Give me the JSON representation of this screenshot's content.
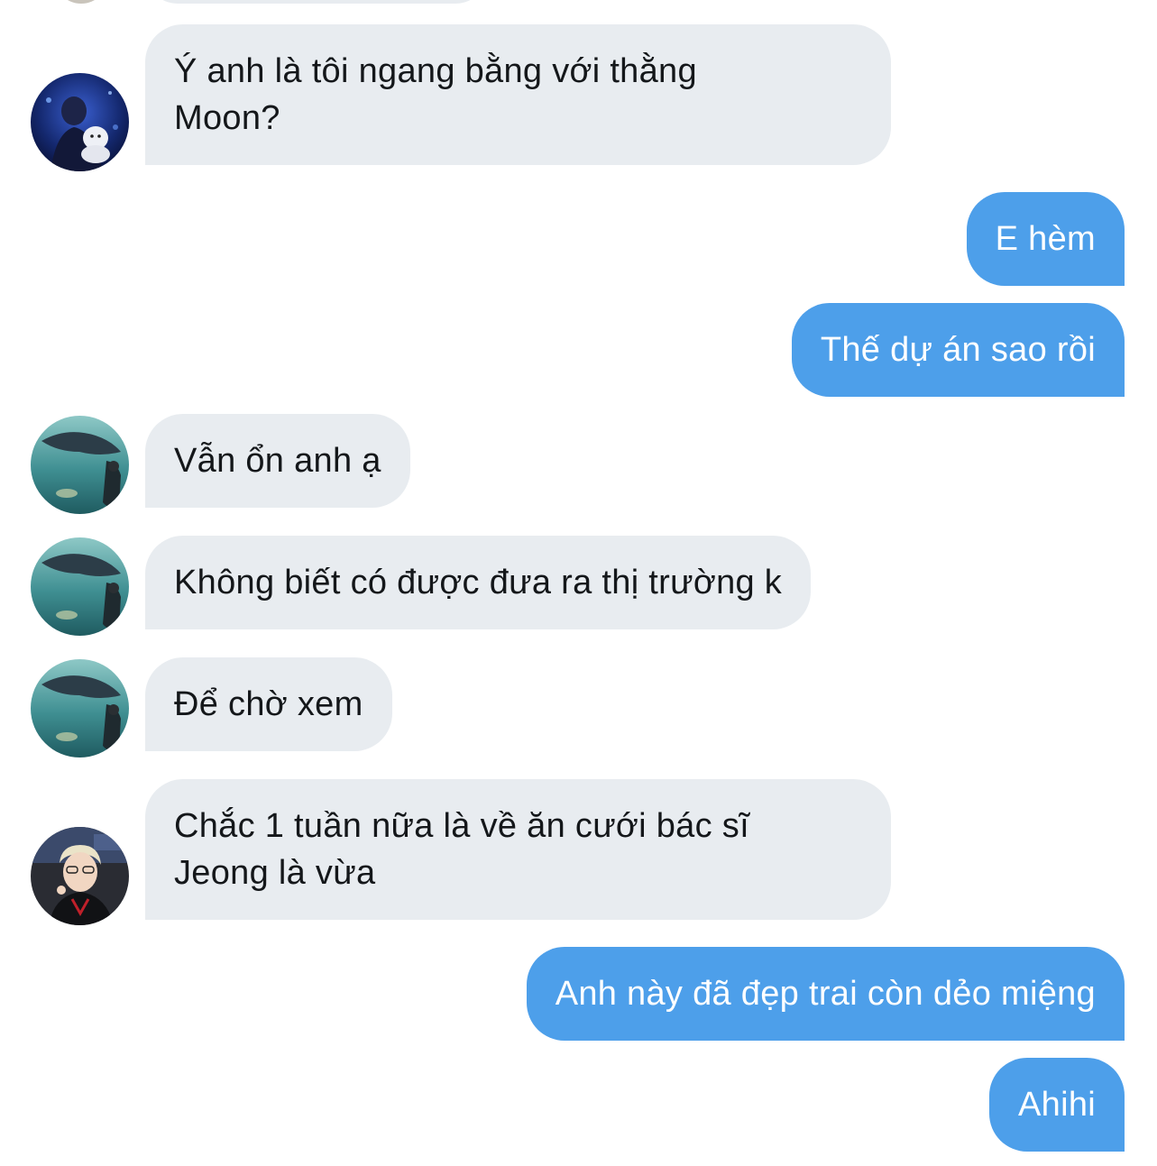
{
  "conversation": {
    "messages": [
      {
        "direction": "in",
        "avatar": "avatar-blue-photo",
        "text": "Ý anh là tôi ngang bằng với thằng\nMoon?"
      },
      {
        "direction": "out",
        "text": "E hèm"
      },
      {
        "direction": "out",
        "text": "Thế dự án sao rồi"
      },
      {
        "direction": "in",
        "avatar": "avatar-aquarium",
        "text": "Vẫn ổn anh ạ"
      },
      {
        "direction": "in",
        "avatar": "avatar-aquarium",
        "text": "Không biết có được đưa ra thị trường k"
      },
      {
        "direction": "in",
        "avatar": "avatar-aquarium",
        "text": "Để chờ xem"
      },
      {
        "direction": "in",
        "avatar": "avatar-blonde-person",
        "text": "Chắc 1 tuần nữa là về ăn cưới bác sĩ\nJeong là vừa"
      },
      {
        "direction": "out",
        "text": "Anh này đã đẹp trai còn dẻo miệng"
      },
      {
        "direction": "out",
        "text": "Ahihi"
      }
    ]
  },
  "colors": {
    "incoming_bubble": "#e8ecf0",
    "outgoing_bubble": "#4d9fea",
    "incoming_text": "#14171a",
    "outgoing_text": "#ffffff",
    "background": "#ffffff"
  }
}
